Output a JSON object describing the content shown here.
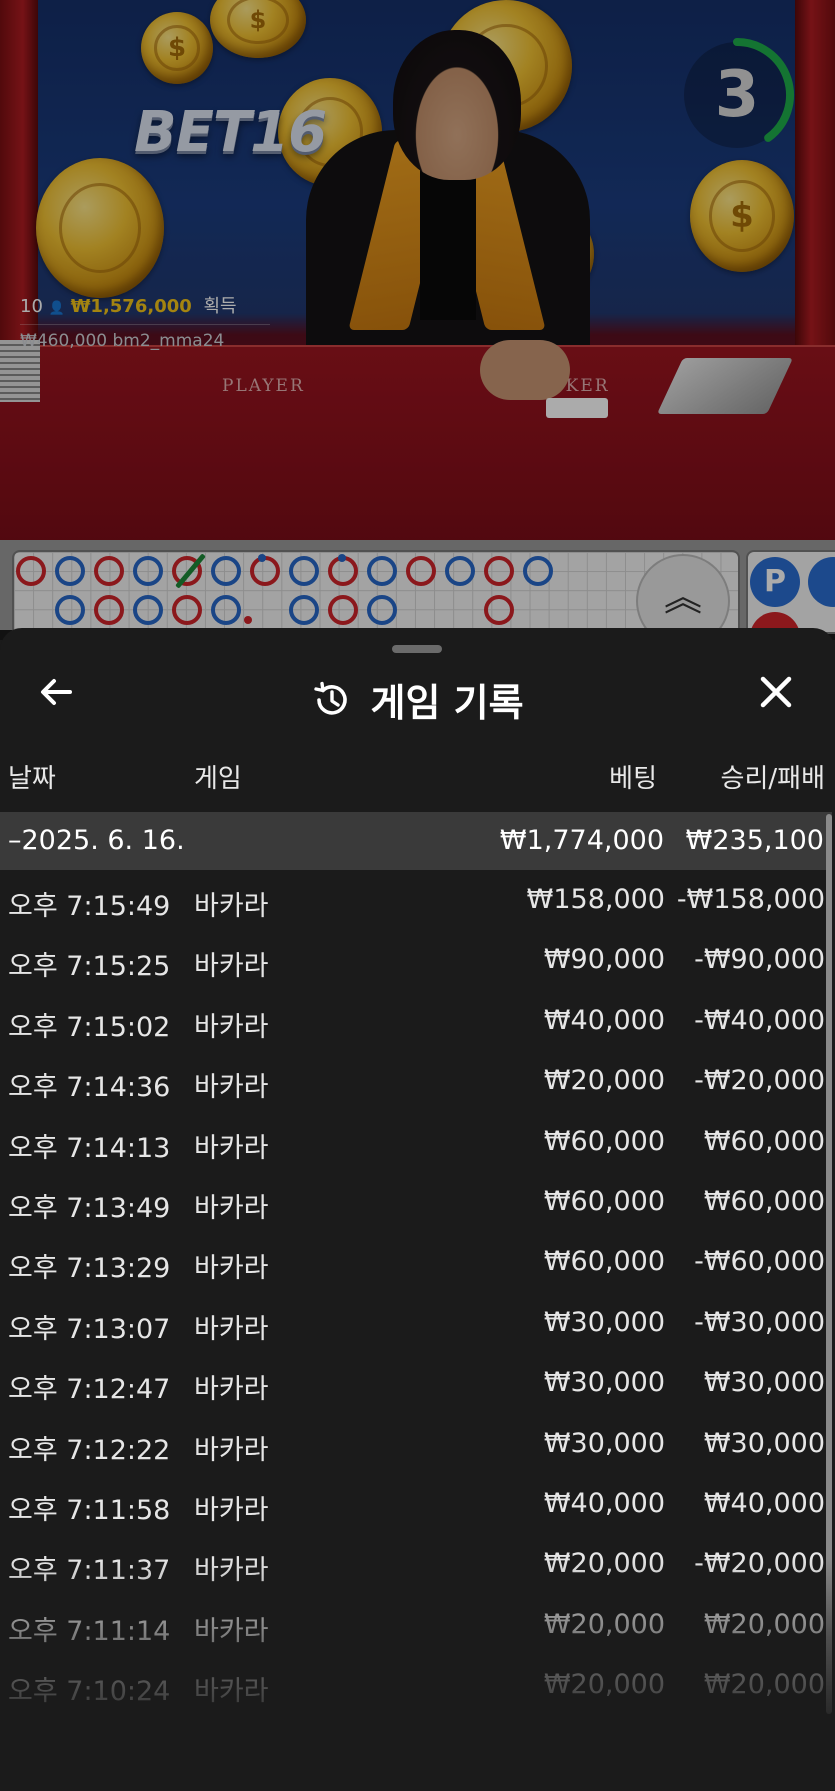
{
  "video": {
    "logo": "BET16",
    "win_count": "10",
    "win_amount": "₩1,576,000",
    "win_label": "획득",
    "player_line": "₩460,000  bm2_mma24",
    "table_player": "PLAYER",
    "table_banker": "BANKER"
  },
  "timer": {
    "value": "3",
    "progress": 0.4,
    "color": "#1fae4b"
  },
  "roadmap": {
    "player_badge": "P"
  },
  "sheet": {
    "title": "게임 기록",
    "columns": {
      "date": "날짜",
      "game": "게임",
      "bet": "베팅",
      "result": "승리/패배"
    },
    "summary": {
      "date": "–2025. 6. 16.",
      "bet": "₩1,774,000",
      "result": "₩235,100"
    },
    "rows": [
      {
        "time": "오후 7:15:49",
        "game": "바카라",
        "bet": "₩158,000",
        "result": "-₩158,000"
      },
      {
        "time": "오후 7:15:25",
        "game": "바카라",
        "bet": "₩90,000",
        "result": "-₩90,000"
      },
      {
        "time": "오후 7:15:02",
        "game": "바카라",
        "bet": "₩40,000",
        "result": "-₩40,000"
      },
      {
        "time": "오후 7:14:36",
        "game": "바카라",
        "bet": "₩20,000",
        "result": "-₩20,000"
      },
      {
        "time": "오후 7:14:13",
        "game": "바카라",
        "bet": "₩60,000",
        "result": "₩60,000"
      },
      {
        "time": "오후 7:13:49",
        "game": "바카라",
        "bet": "₩60,000",
        "result": "₩60,000"
      },
      {
        "time": "오후 7:13:29",
        "game": "바카라",
        "bet": "₩60,000",
        "result": "-₩60,000"
      },
      {
        "time": "오후 7:13:07",
        "game": "바카라",
        "bet": "₩30,000",
        "result": "-₩30,000"
      },
      {
        "time": "오후 7:12:47",
        "game": "바카라",
        "bet": "₩30,000",
        "result": "₩30,000"
      },
      {
        "time": "오후 7:12:22",
        "game": "바카라",
        "bet": "₩30,000",
        "result": "₩30,000"
      },
      {
        "time": "오후 7:11:58",
        "game": "바카라",
        "bet": "₩40,000",
        "result": "₩40,000"
      },
      {
        "time": "오후 7:11:37",
        "game": "바카라",
        "bet": "₩20,000",
        "result": "-₩20,000"
      },
      {
        "time": "오후 7:11:14",
        "game": "바카라",
        "bet": "₩20,000",
        "result": "₩20,000"
      },
      {
        "time": "오후 7:10:24",
        "game": "바카라",
        "bet": "₩20,000",
        "result": "₩20,000"
      }
    ]
  },
  "colors": {
    "sheet_bg": "#1b1b1b",
    "summary_bg": "#3a3a3a",
    "gold": "#f5c518",
    "banker_red": "#d0242a",
    "player_blue": "#2868c8"
  },
  "icons": {
    "back": "arrow-left-icon",
    "history": "history-icon",
    "close": "close-icon",
    "expand": "chevron-double-up-icon"
  }
}
